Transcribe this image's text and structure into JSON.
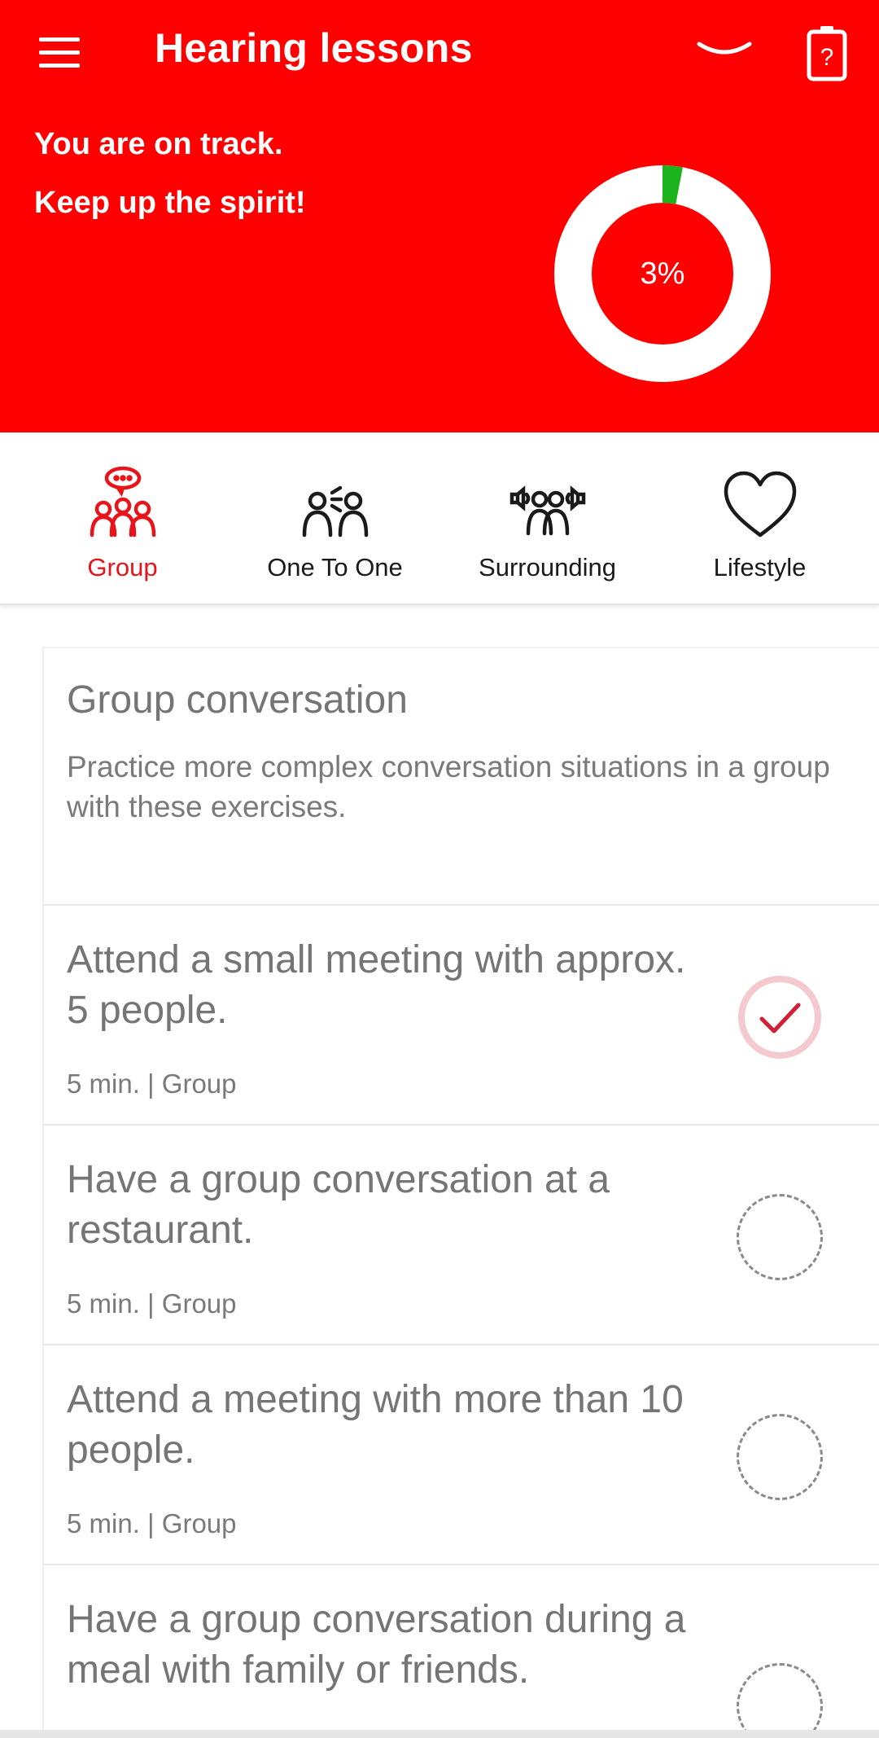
{
  "header": {
    "title": "Hearing lessons",
    "message_line1": "You are on track.",
    "message_line2": "Keep up the spirit!",
    "progress_text": "3%",
    "progress_fraction": 0.03,
    "colors": {
      "background": "#ff0000",
      "progress": "#1db31d",
      "ring": "#ffffff"
    },
    "icons": {
      "menu": "hamburger-menu-icon",
      "collapse": "chevron-down-icon",
      "battery": "battery-help-icon"
    }
  },
  "tabs": [
    {
      "label": "Group",
      "icon": "group-chat-icon",
      "active": true
    },
    {
      "label": "One To One",
      "icon": "one-to-one-icon",
      "active": false
    },
    {
      "label": "Surrounding",
      "icon": "surrounding-sound-icon",
      "active": false
    },
    {
      "label": "Lifestyle",
      "icon": "heart-icon",
      "active": false
    }
  ],
  "intro": {
    "title": "Group conversation",
    "description": "Practice more complex conversation situations in a group with these exercises."
  },
  "lessons": [
    {
      "title": "Attend a small meeting with approx. 5 people.",
      "duration": "5 min.",
      "separator": "|",
      "category": "Group",
      "done": true
    },
    {
      "title": "Have a group conversation at a restaurant.",
      "duration": "5 min.",
      "separator": "|",
      "category": "Group",
      "done": false
    },
    {
      "title": "Attend a meeting with more than 10 people.",
      "duration": "5 min.",
      "separator": "|",
      "category": "Group",
      "done": false
    },
    {
      "title": "Have a group conversation during a meal with family or friends.",
      "duration": "",
      "separator": "",
      "category": "",
      "done": false
    }
  ]
}
